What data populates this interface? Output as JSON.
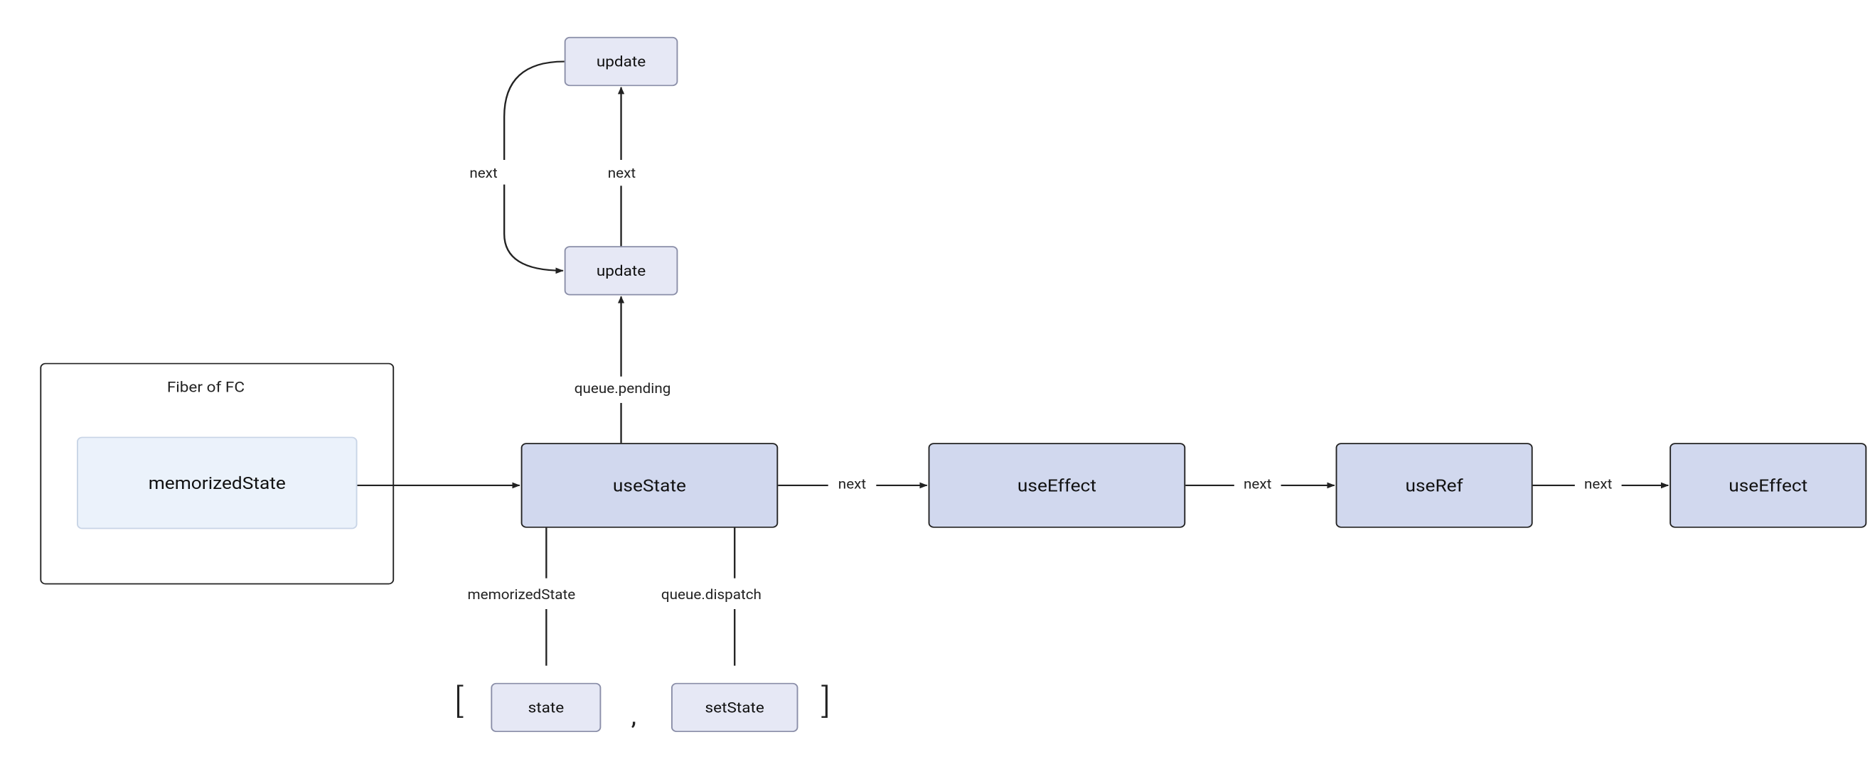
{
  "group": {
    "label": "Fiber of FC"
  },
  "nodes": {
    "memorizedState": "memorizedState",
    "useState": "useState",
    "useEffect1": "useEffect",
    "useRef": "useRef",
    "useEffect2": "useEffect",
    "updateTop": "update",
    "updateMid": "update",
    "state": "state",
    "setState": "setState"
  },
  "edges": {
    "fiberToUseState": "",
    "useStateToUseEffect": "next",
    "useEffectToUseRef": "next",
    "useRefToUseEffect2": "next",
    "useStateUpQueuePending": "queue.pending",
    "updateMidToTopNext": "next",
    "updateTopToMidNext": "next",
    "useStateToStateMemorized": "memorizedState",
    "useStateToSetStateDispatch": "queue.dispatch"
  },
  "brackets": {
    "left": "[",
    "comma": ",",
    "right": "]"
  }
}
